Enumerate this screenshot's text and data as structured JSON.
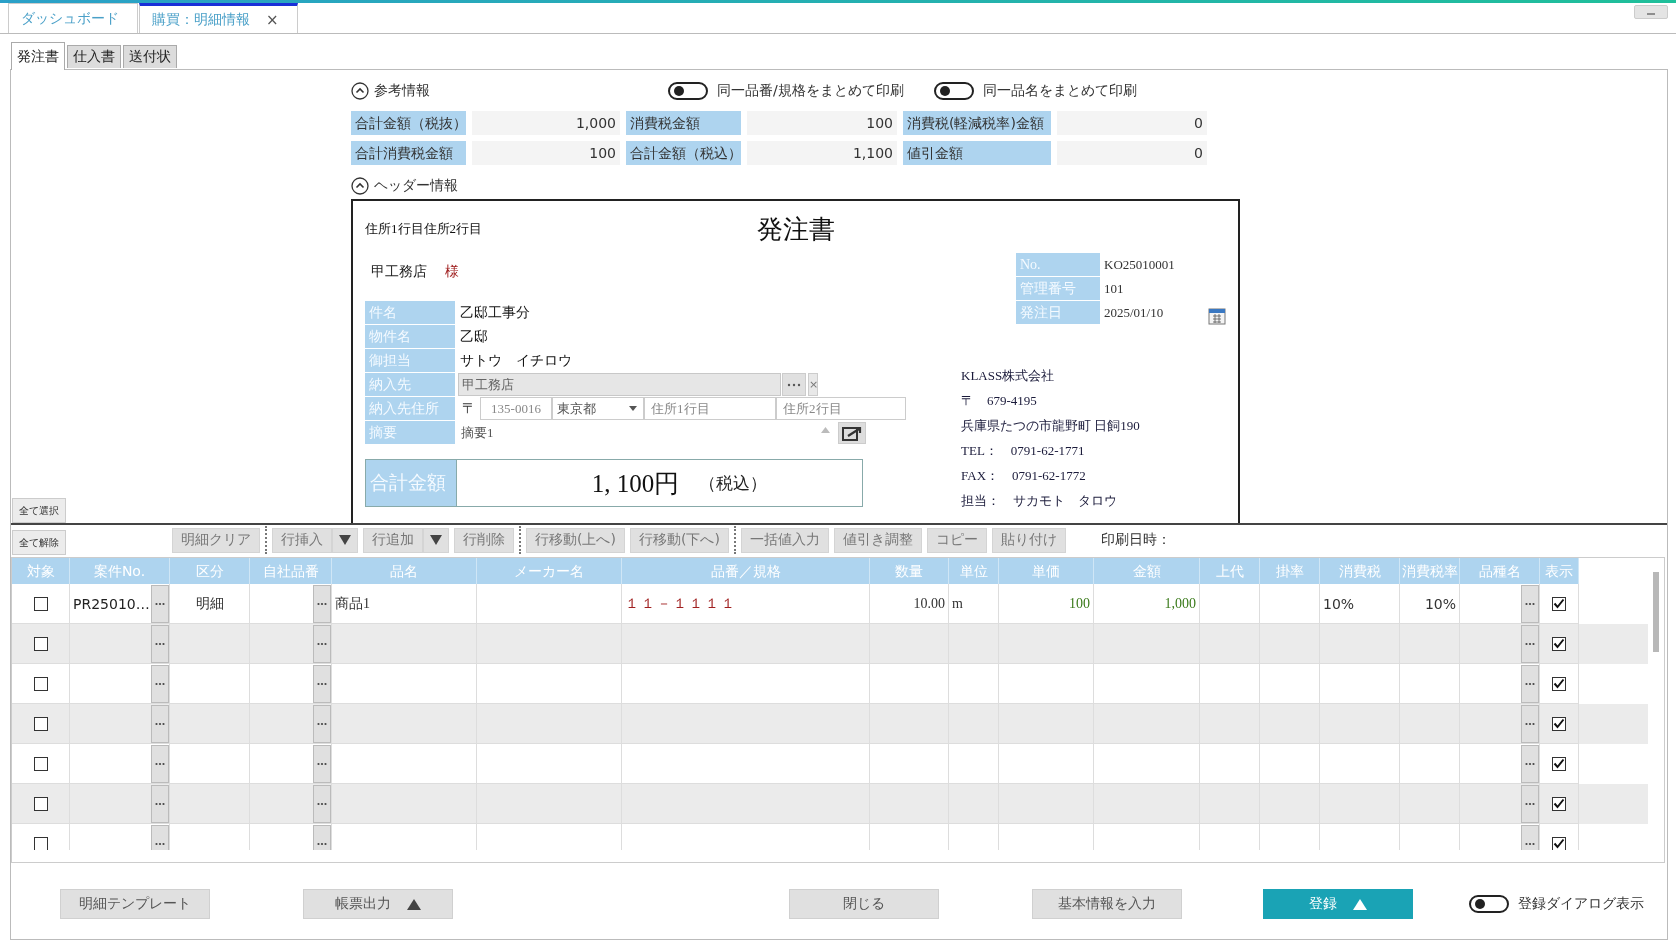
{
  "doc_tabs": [
    {
      "label": "ダッシュボード",
      "selected": false
    },
    {
      "label": "購買：明細情報",
      "selected": true,
      "close": "×"
    }
  ],
  "sub_tabs": [
    {
      "label": "発注書",
      "selected": true
    },
    {
      "label": "仕入書",
      "selected": false
    },
    {
      "label": "送付状",
      "selected": false
    }
  ],
  "reference": {
    "title": "参考情報",
    "expanded": true,
    "toggles": [
      {
        "label": "同一品番/規格をまとめて印刷",
        "on": false
      },
      {
        "label": "同一品名をまとめて印刷",
        "on": false
      }
    ],
    "summary": [
      {
        "label": "合計金額（税抜）",
        "value": "1,000"
      },
      {
        "label": "消費税金額",
        "value": "100"
      },
      {
        "label": "消費税(軽減税率)金額",
        "value": "0"
      },
      {
        "label": "合計消費税金額",
        "value": "100"
      },
      {
        "label": "合計金額（税込）",
        "value": "1,100"
      },
      {
        "label": "値引金額",
        "value": "0"
      }
    ]
  },
  "header_section": {
    "title": "ヘッダー情報",
    "expanded": true
  },
  "document": {
    "address_line": "住所1行目住所2行目",
    "title": "発注書",
    "recipient": "甲工務店",
    "honorific": "様",
    "fields": [
      {
        "label": "件名",
        "value": "乙邸工事分"
      },
      {
        "label": "物件名",
        "value": "乙邸"
      },
      {
        "label": "御担当",
        "value": "サトウ　イチロウ"
      }
    ],
    "delivery": {
      "label": "納入先",
      "value": "甲工務店",
      "clear": "×"
    },
    "delivery_address": {
      "label": "納入先住所",
      "postal_mark": "〒",
      "postal_code": "135-0016",
      "prefecture": "東京都",
      "address1_placeholder": "住所1行目",
      "address2_placeholder": "住所2行目"
    },
    "memo": {
      "label": "摘要",
      "value": "摘要1"
    },
    "total": {
      "label": "合計金額",
      "amount": "1, 100円",
      "tax_note": "（税込）"
    },
    "meta": [
      {
        "label": "No.",
        "value": "KO25010001"
      },
      {
        "label": "管理番号",
        "value": "101"
      },
      {
        "label": "発注日",
        "value": "2025/01/10"
      }
    ],
    "company": [
      "KLASS株式会社",
      "〒　679-4195",
      "兵庫県たつの市龍野町 日飼190",
      "TEL：　0791-62-1771",
      "FAX：　0791-62-1772",
      "担当：　サカモト　タロウ"
    ]
  },
  "select_buttons": [
    "全て選択",
    "全て解除"
  ],
  "toolbar_groups": [
    [
      {
        "label": "明細クリア",
        "dropdown": false
      }
    ],
    [
      {
        "label": "行挿入",
        "dropdown": true
      },
      {
        "label": "行追加",
        "dropdown": true
      },
      {
        "label": "行削除",
        "dropdown": false
      }
    ],
    [
      {
        "label": "行移動(上へ)",
        "dropdown": false
      },
      {
        "label": "行移動(下へ)",
        "dropdown": false
      }
    ],
    [
      {
        "label": "一括値入力",
        "dropdown": false
      },
      {
        "label": "値引き調整",
        "dropdown": false
      },
      {
        "label": "コピー",
        "dropdown": false
      },
      {
        "label": "貼り付け",
        "dropdown": false
      }
    ]
  ],
  "print_datetime_label": "印刷日時：",
  "grid": {
    "columns": [
      {
        "label": "対象",
        "kind": "check"
      },
      {
        "label": "案件No.",
        "kind": "lookup"
      },
      {
        "label": "区分",
        "kind": "text"
      },
      {
        "label": "自社品番",
        "kind": "lookup"
      },
      {
        "label": "品名",
        "kind": "text"
      },
      {
        "label": "メーカー名",
        "kind": "text"
      },
      {
        "label": "品番／規格",
        "kind": "text"
      },
      {
        "label": "数量",
        "kind": "text"
      },
      {
        "label": "単位",
        "kind": "text"
      },
      {
        "label": "単価",
        "kind": "text"
      },
      {
        "label": "金額",
        "kind": "text"
      },
      {
        "label": "上代",
        "kind": "text"
      },
      {
        "label": "掛率",
        "kind": "text"
      },
      {
        "label": "消費税",
        "kind": "text"
      },
      {
        "label": "消費税率",
        "kind": "text"
      },
      {
        "label": "品種名",
        "kind": "lookup"
      },
      {
        "label": "表示",
        "kind": "check"
      }
    ],
    "rows": [
      {
        "cells": [
          false,
          "PR25010…",
          "明細",
          null,
          "商品1",
          null,
          "１１－１１１１",
          "10.00",
          "m",
          "100",
          "1,000",
          null,
          null,
          "10%",
          "10%",
          null,
          true
        ]
      },
      {
        "cells": [
          false,
          null,
          null,
          null,
          null,
          null,
          null,
          null,
          null,
          null,
          null,
          null,
          null,
          null,
          null,
          null,
          true
        ]
      },
      {
        "cells": [
          false,
          null,
          null,
          null,
          null,
          null,
          null,
          null,
          null,
          null,
          null,
          null,
          null,
          null,
          null,
          null,
          true
        ]
      },
      {
        "cells": [
          false,
          null,
          null,
          null,
          null,
          null,
          null,
          null,
          null,
          null,
          null,
          null,
          null,
          null,
          null,
          null,
          true
        ]
      },
      {
        "cells": [
          false,
          null,
          null,
          null,
          null,
          null,
          null,
          null,
          null,
          null,
          null,
          null,
          null,
          null,
          null,
          null,
          true
        ]
      },
      {
        "cells": [
          false,
          null,
          null,
          null,
          null,
          null,
          null,
          null,
          null,
          null,
          null,
          null,
          null,
          null,
          null,
          null,
          true
        ]
      },
      {
        "cells": [
          false,
          null,
          null,
          null,
          null,
          null,
          null,
          null,
          null,
          null,
          null,
          null,
          null,
          null,
          null,
          null,
          true
        ]
      }
    ]
  },
  "footer_buttons": [
    {
      "label": "明細テンプレート",
      "kind": "plain",
      "menu": false
    },
    {
      "label": "帳票出力",
      "kind": "plain",
      "menu": true
    },
    {
      "label": "閉じる",
      "kind": "plain",
      "menu": false
    },
    {
      "label": "基本情報を入力",
      "kind": "plain",
      "menu": false
    },
    {
      "label": "登録",
      "kind": "primary",
      "menu": true
    }
  ],
  "dialog_toggle": {
    "label": "登録ダイアログ表示",
    "on": false
  }
}
